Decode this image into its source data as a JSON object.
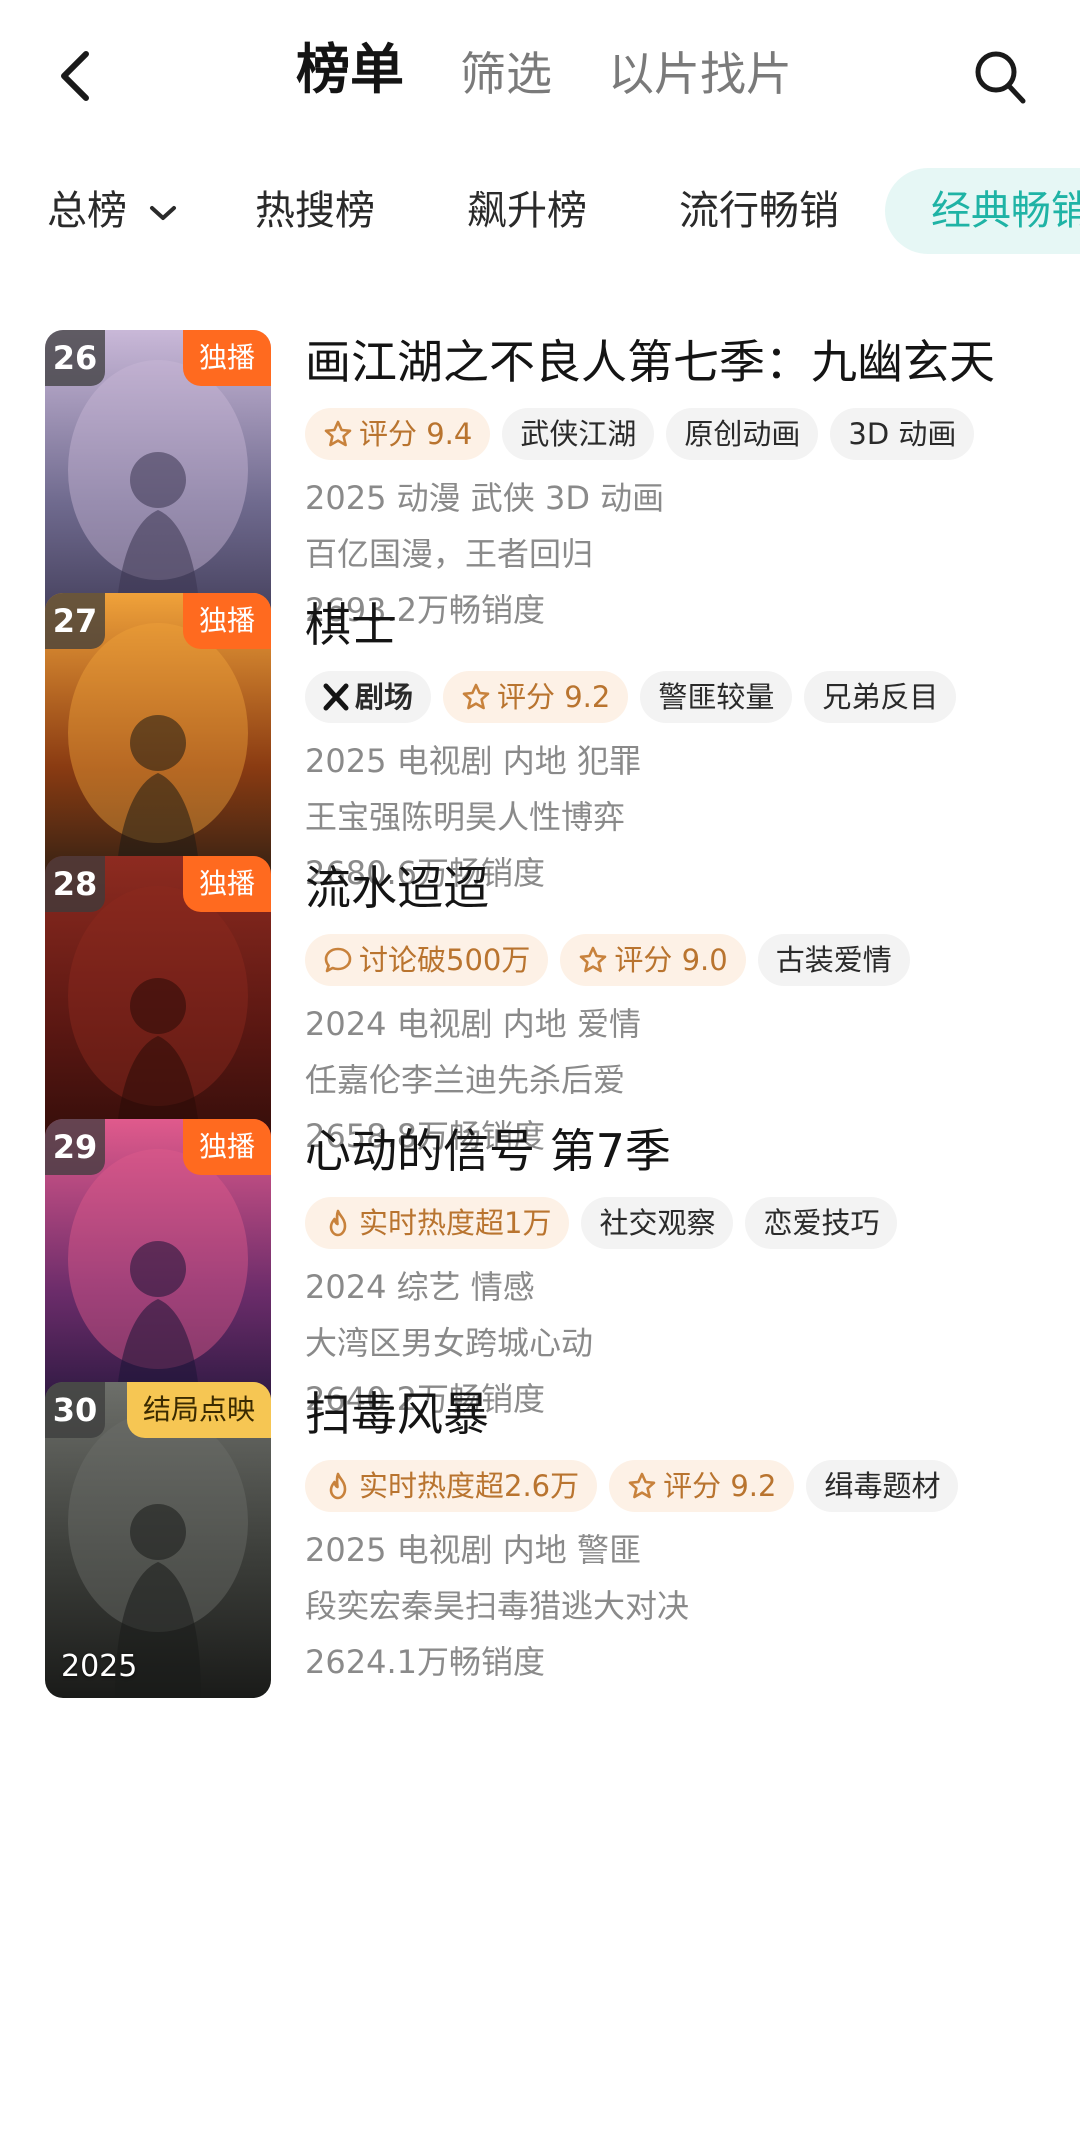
{
  "header": {
    "tabs": [
      {
        "label": "榜单",
        "active": true
      },
      {
        "label": "筛选",
        "active": false
      },
      {
        "label": "以片找片",
        "active": false
      }
    ]
  },
  "subtabs": [
    {
      "label": "总榜",
      "active": false
    },
    {
      "label": "热搜榜",
      "active": false
    },
    {
      "label": "飙升榜",
      "active": false
    },
    {
      "label": "流行畅销",
      "active": false
    },
    {
      "label": "经典畅销",
      "active": true
    }
  ],
  "items": [
    {
      "rank": "26",
      "badge": "独播",
      "year": "2025",
      "title": "画江湖之不良人第七季：九幽玄天",
      "tags": [
        {
          "text": "评分 9.4",
          "kind": "rating"
        },
        {
          "text": "武侠江湖",
          "kind": "plain"
        },
        {
          "text": "原创动画",
          "kind": "plain"
        },
        {
          "text": "3D 动画",
          "kind": "plain"
        }
      ],
      "meta": "2025 动漫 武侠 3D 动画",
      "desc": "百亿国漫，王者回归",
      "sales": "2693.2万畅销度",
      "poster_colors": [
        "#c9b8d8",
        "#6f6a8e",
        "#3a3550"
      ]
    },
    {
      "rank": "27",
      "badge": "独播",
      "year": "2025",
      "title": "棋士",
      "tags": [
        {
          "text": "X剧场",
          "kind": "brand"
        },
        {
          "text": "评分 9.2",
          "kind": "rating"
        },
        {
          "text": "警匪较量",
          "kind": "plain"
        },
        {
          "text": "兄弟反目",
          "kind": "plain"
        }
      ],
      "meta": "2025 电视剧 内地 犯罪",
      "desc": "王宝强陈明昊人性博弈",
      "sales": "2680.6万畅销度",
      "poster_colors": [
        "#f0a23a",
        "#8a3b12",
        "#1d1a14"
      ]
    },
    {
      "rank": "28",
      "badge": "独播",
      "year": "2024",
      "title": "流水迢迢",
      "tags": [
        {
          "text": "讨论破500万",
          "kind": "discuss"
        },
        {
          "text": "评分 9.0",
          "kind": "rating"
        },
        {
          "text": "古装爱情",
          "kind": "plain"
        }
      ],
      "meta": "2024 电视剧 内地 爱情",
      "desc": "任嘉伦李兰迪先杀后爱",
      "sales": "2658.8万畅销度",
      "poster_colors": [
        "#8e2b20",
        "#5a1712",
        "#2a0b08"
      ]
    },
    {
      "rank": "29",
      "badge": "独播",
      "year": "2024",
      "title": "心动的信号 第7季",
      "tags": [
        {
          "text": "实时热度超1万",
          "kind": "hot"
        },
        {
          "text": "社交观察",
          "kind": "plain"
        },
        {
          "text": "恋爱技巧",
          "kind": "plain"
        }
      ],
      "meta": "2024 综艺 情感",
      "desc": "大湾区男女跨城心动",
      "sales": "2640.2万畅销度",
      "poster_colors": [
        "#e05a8c",
        "#6b2c6a",
        "#1c1436"
      ]
    },
    {
      "rank": "30",
      "badge": "结局点映",
      "year": "2025",
      "title": "扫毒风暴",
      "tags": [
        {
          "text": "实时热度超2.6万",
          "kind": "hot"
        },
        {
          "text": "评分 9.2",
          "kind": "rating"
        },
        {
          "text": "缉毒题材",
          "kind": "plain"
        }
      ],
      "meta": "2025 电视剧 内地 警匪",
      "desc": "段奕宏秦昊扫毒猎逃大对决",
      "sales": "2624.1万畅销度",
      "poster_colors": [
        "#6d6f6a",
        "#3c3e3a",
        "#1a1b19"
      ]
    }
  ]
}
